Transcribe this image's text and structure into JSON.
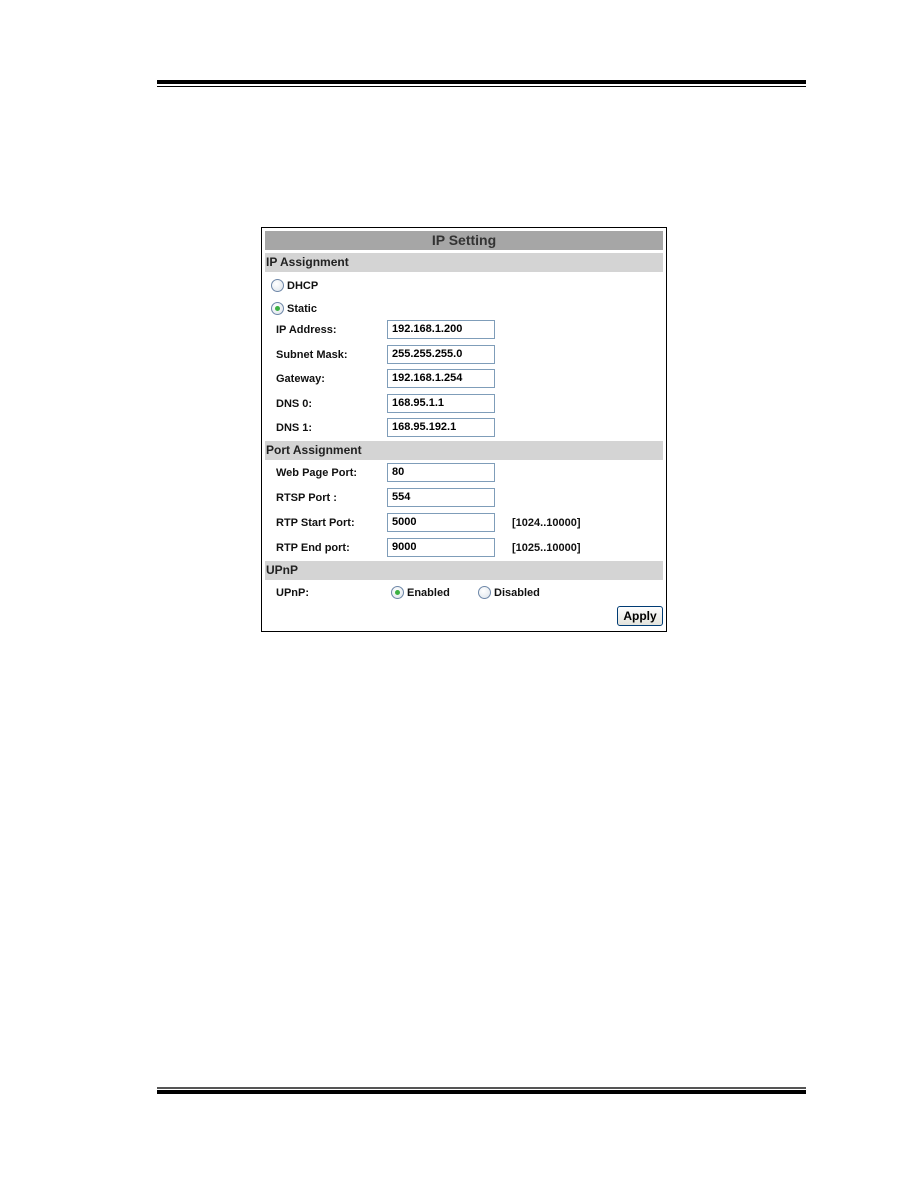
{
  "panel": {
    "title": "IP Setting",
    "ip_assignment": {
      "heading": "IP Assignment",
      "modes": [
        {
          "label": "DHCP",
          "checked": false
        },
        {
          "label": "Static",
          "checked": true
        }
      ],
      "fields": [
        {
          "label": "IP Address:",
          "value": "192.168.1.200"
        },
        {
          "label": "Subnet Mask:",
          "value": "255.255.255.0"
        },
        {
          "label": "Gateway:",
          "value": "192.168.1.254"
        },
        {
          "label": "DNS 0:",
          "value": "168.95.1.1"
        },
        {
          "label": "DNS 1:",
          "value": "168.95.192.1"
        }
      ]
    },
    "port_assignment": {
      "heading": "Port Assignment",
      "fields": [
        {
          "label": "Web Page Port:",
          "value": "80",
          "range": ""
        },
        {
          "label": "RTSP Port :",
          "value": "554",
          "range": ""
        },
        {
          "label": "RTP Start Port:",
          "value": "5000",
          "range": "[1024..10000]"
        },
        {
          "label": "RTP End port:",
          "value": "9000",
          "range": "[1025..10000]"
        }
      ]
    },
    "upnp": {
      "heading": "UPnP",
      "label": "UPnP:",
      "options": [
        {
          "label": "Enabled",
          "checked": true
        },
        {
          "label": "Disabled",
          "checked": false
        }
      ]
    },
    "apply_label": "Apply"
  }
}
